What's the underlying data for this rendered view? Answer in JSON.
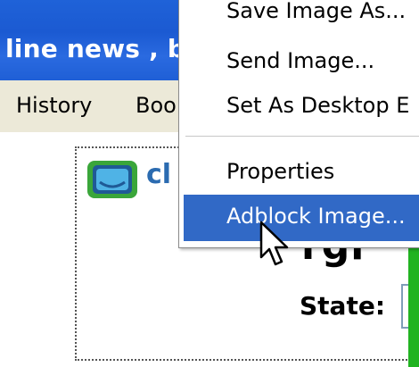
{
  "browser": {
    "title": "line news , b"
  },
  "menubar": {
    "items": [
      {
        "label": "History"
      },
      {
        "label": "Boo"
      }
    ]
  },
  "page": {
    "logo_text": "cl",
    "heading_fragment": "rgi",
    "state_label": "State:"
  },
  "context_menu": {
    "items": [
      {
        "label": "Save Image As..."
      },
      {
        "label": "Send Image..."
      },
      {
        "label": "Set As Desktop E"
      },
      {
        "label": "Properties"
      },
      {
        "label": "Adblock Image..."
      }
    ],
    "highlighted_index": 4
  },
  "colors": {
    "titlebar": "#1f62d8",
    "highlight": "#3169c6",
    "menubar": "#ece9d8",
    "window_border": "#21b321",
    "logo": "#2b6bb0"
  },
  "icons": {
    "logo": "tv-screen-logo-icon",
    "cursor": "arrow-pointer-icon"
  }
}
